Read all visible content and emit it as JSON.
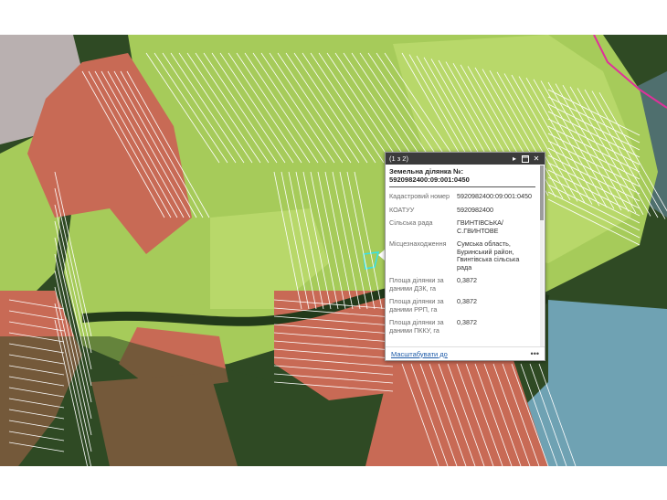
{
  "map": {
    "colors": {
      "water": "#4f6f6e",
      "forest": "#2f4a24",
      "parcel_green": "#a6cb5a",
      "parcel_green_light": "#b8d86a",
      "parcel_red": "#c86a55",
      "parcel_gray": "#b9b0b0",
      "parcel_blue": "#6fa2b3",
      "parcel_outline": "#ffffff",
      "selected": "#38e0e6",
      "boundary": "#e0309a"
    }
  },
  "popup": {
    "count": "(1 з 2)",
    "title": "Земельна ділянка №: 5920982400:09:001:0450",
    "fields": [
      {
        "label": "Кадастровий номер",
        "value": "5920982400:09:001:0450"
      },
      {
        "label": "КОАТУУ",
        "value": "5920982400"
      },
      {
        "label": "Сільська рада",
        "value": "ГВИНТІВСЬКА/ С.ГВИНТОВЕ"
      },
      {
        "label": "Місцезнаходження",
        "value": "Сумська область, Буринський район, Гвинтівська сільська рада"
      },
      {
        "label": "Площа ділянки за даними ДЗК, га",
        "value": "0,3872"
      },
      {
        "label": "Площа ділянки за даними РРП, га",
        "value": "0,3872"
      },
      {
        "label": "Площа ділянки за даними ПККУ, га",
        "value": "0,3872"
      }
    ],
    "zoom_label": "Масштабувати до",
    "more_label": "•••",
    "icons": [
      "next-icon",
      "maximize-icon",
      "close-icon"
    ]
  }
}
